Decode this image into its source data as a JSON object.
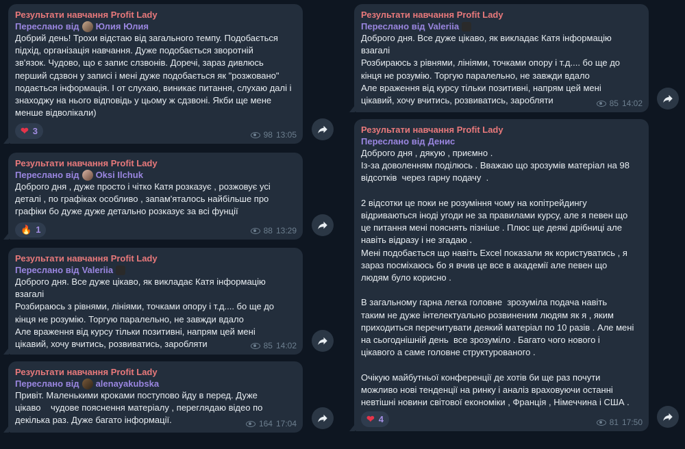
{
  "messages": [
    {
      "channel": "Результати навчання Profit Lady",
      "forwarded_label": "Переслано від",
      "forwarded_from": "Юлия Юлия",
      "text": "Добрий день! Трохи відстаю від загального темпу. Подобається\nпідхід, організація навчання. Дуже подобається зворотній\nзв'язок. Чудово, що є запис слзвонів. Доречі, зараз дивлюсь\nперший сдзвон у записі і мені дуже подобається як \"розжовано\"\nподається інформація. І от слухаю, виникає питання, слухаю далі і\nзнаходжу на нього відповідь у цьому ж сдзвоні. Якби ще мене\nменше відволікали)",
      "reaction_emoji": "heart-red",
      "reaction_count": "3",
      "views": "98",
      "time": "13:05"
    },
    {
      "channel": "Результати навчання Profit Lady",
      "forwarded_label": "Переслано від",
      "forwarded_from": "Oksi Ilchuk",
      "text": "Доброго дня , дуже просто і чітко Катя розказує , розжовує усі\nдеталі , по графіках особливо , запам'яталось найбільше про\nграфіки бо дуже дуже детально розказує за всі фунції",
      "reaction_emoji": "fire",
      "reaction_count": "1",
      "views": "88",
      "time": "13:29"
    },
    {
      "channel": "Результати навчання Profit Lady",
      "forwarded_label": "Переслано від",
      "forwarded_from": "Valeriia",
      "text": "Доброго дня. Все дуже цікаво, як викладає Катя інформацію\nвзагалі\nРозбираюсь з рівнями, лініями, точками опору і т.д.... бо ще до\nкінця не розумію. Торгую паралельно, не завжди вдало\nАле враження від курсу тільки позитивні, напрям цей мені\nцікавий, хочу вчитись, розвиватись, заробляти",
      "views": "85",
      "time": "14:02"
    },
    {
      "channel": "Результати навчання Profit Lady",
      "forwarded_label": "Переслано від",
      "forwarded_from": "alenayakubska",
      "text": "Привіт. Маленькими кроками поступово йду в перед. Дуже\nцікаво    чудове пояснення матеріалу , переглядаю відео по\nдекілька раз. Дуже багато інформації.",
      "views": "164",
      "time": "17:04"
    },
    {
      "channel": "Результати навчання Profit Lady",
      "forwarded_label": "Переслано від",
      "forwarded_from": "Valeriia",
      "text": "Доброго дня. Все дуже цікаво, як викладає Катя інформацію\nвзагалі\nРозбираюсь з рівнями, лініями, точками опору і т.д.... бо ще до\nкінця не розумію. Торгую паралельно, не завжди вдало\nАле враження від курсу тільки позитивні, напрям цей мені\nцікавий, хочу вчитись, розвиватись, заробляти",
      "views": "85",
      "time": "14:02"
    },
    {
      "channel": "Результати навчання Profit Lady",
      "forwarded_label": "Переслано від",
      "forwarded_from": "Денис",
      "text": "Доброго дня , дякую , приємно .\nІз-за доволенням поділюсь . Вважаю що зрозумів матеріал на 98\nвідсотків  через гарну подачу  .\n\n2 відсотки це поки не розуміння чому на копітрейдингу\nвідриваються іноді угоди не за правилами курсу, але я певен що\nце питання мені пояснять пізніше . Плюс ще деякі дрібниці але\nнавіть відразу і не згадаю .\nМені подобається що навіть Excel показали як користуватись , я\nзараз посміхаюсь бо я вчив це все в академії але певен що\nлюдям було корисно .\n\nВ загальному гарна легка головне  зрозуміла подача навіть\nтаким не дуже інтелектуально розвиненим людям як я , яким\nприходиться перечитувати деякий матеріал по 10 разів . Але мені\nна сьогоднішній день  все зрозуміло . Багато чого нового і\nцікавого а саме головне структурованого .\n\nОчікую майбутньої конференції де хотів би ще раз почути\nможливо нові тенденції на ринку і аналіз враховуючи останні\nневтішні новини світової економіки , Франція , Німеччина і США .",
      "reaction_emoji": "heart-red",
      "reaction_count": "4",
      "views": "81",
      "time": "17:50"
    }
  ],
  "colors": {
    "background": "#0e1621",
    "bubble": "#232e3c",
    "channel_name": "#e8797b",
    "forward_name": "#9a86e0",
    "meta": "#6d7f8f"
  }
}
